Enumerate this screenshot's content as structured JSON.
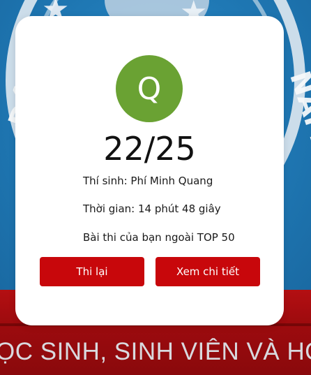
{
  "background": {
    "emblem_letters_left": "ĐỘI",
    "emblem_letters_right": "NAM",
    "banner_text": "ỌC SINH, SINH VIÊN VÀ HỌ"
  },
  "result": {
    "avatar_letter": "Q",
    "score": "22/25",
    "candidate": "Thí sinh: Phí Minh Quang",
    "duration": "Thời gian: 14 phút 48 giây",
    "ranking": "Bài thi của bạn ngoài TOP 50",
    "retry_label": "Thi lại",
    "details_label": "Xem chi tiết"
  },
  "colors": {
    "avatar_bg": "#6aa233",
    "button_bg": "#c8070b",
    "background_blue": "#1f7bb8",
    "background_red": "#9d0b0e"
  }
}
